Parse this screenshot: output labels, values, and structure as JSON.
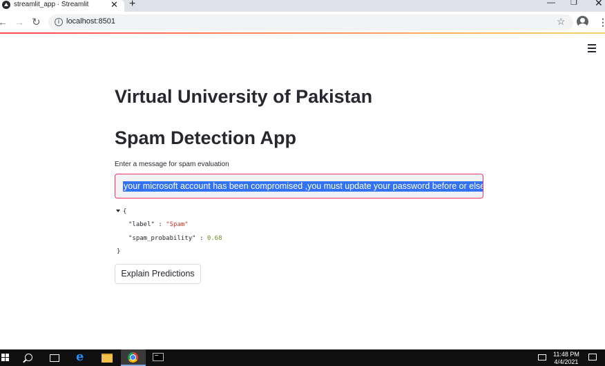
{
  "browser": {
    "tab_title": "streamlit_app · Streamlit",
    "tab_close": "✕",
    "new_tab": "+",
    "url": "localhost:8501",
    "window_controls": {
      "minimize": "—",
      "maximize": "❐",
      "close": "✕"
    },
    "nav": {
      "back": "←",
      "forward": "→",
      "reload": "↻",
      "info": "i",
      "star": "☆",
      "menu": "⋮"
    }
  },
  "page": {
    "title1": "Virtual University of Pakistan",
    "title2": "Spam Detection App",
    "input_label": "Enter a message for spam evaluation",
    "input_value": "your microsoft account has been compromised ,you must update your password before or else",
    "json_output": {
      "open_brace": "{",
      "close_brace": "}",
      "label_key": "\"label\"",
      "label_value": "\"Spam\"",
      "prob_key": "\"spam_probability\"",
      "prob_value": "0.68",
      "sep": " : "
    },
    "explain_button": "Explain Predictions"
  },
  "taskbar": {
    "time": "11:48 PM",
    "date": "4/4/2021"
  },
  "colors": {
    "accent": "#f63366",
    "selection": "#3372f2",
    "text": "#262730"
  }
}
